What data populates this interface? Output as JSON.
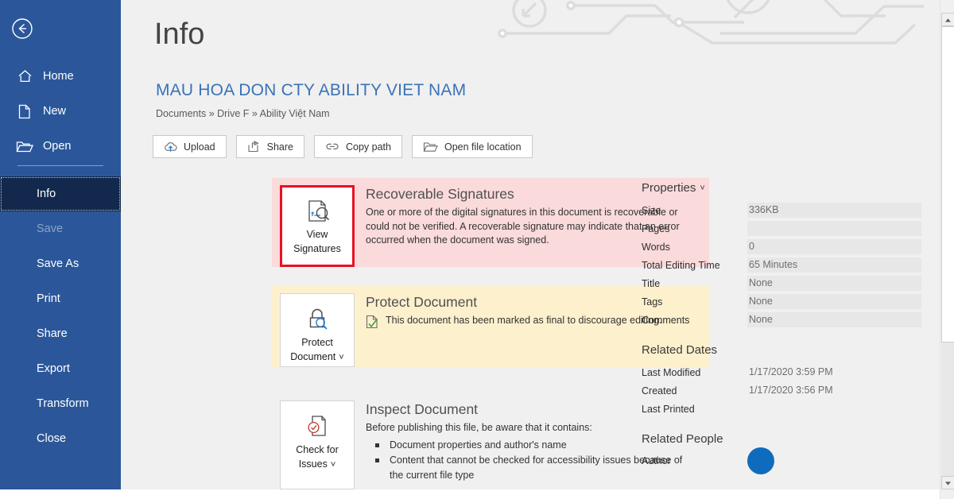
{
  "app": {
    "page_title": "Info"
  },
  "sidebar": {
    "back_icon": "back-arrow-icon",
    "top_items": [
      {
        "label": "Home",
        "icon": "home-icon"
      },
      {
        "label": "New",
        "icon": "new-document-icon"
      },
      {
        "label": "Open",
        "icon": "open-folder-icon"
      }
    ],
    "items": [
      {
        "label": "Info",
        "state": "selected"
      },
      {
        "label": "Save",
        "state": "disabled"
      },
      {
        "label": "Save As",
        "state": "normal"
      },
      {
        "label": "Print",
        "state": "normal"
      },
      {
        "label": "Share",
        "state": "normal"
      },
      {
        "label": "Export",
        "state": "normal"
      },
      {
        "label": "Transform",
        "state": "normal"
      },
      {
        "label": "Close",
        "state": "normal"
      }
    ]
  },
  "document": {
    "title": "MAU HOA DON CTY ABILITY VIET NAM",
    "breadcrumb": "Documents » Drive F » Ability Việt Nam"
  },
  "toolbar": {
    "upload_label": "Upload",
    "share_label": "Share",
    "copy_path_label": "Copy path",
    "open_file_location_label": "Open file location"
  },
  "panels": {
    "signatures": {
      "button_line1": "View",
      "button_line2": "Signatures",
      "heading": "Recoverable Signatures",
      "body": "One or more of the digital signatures in this document is recoverable or could not be verified. A recoverable signature may indicate that an error occurred when the document was signed.",
      "bg_color": "#fadada",
      "focus_color": "#e81123"
    },
    "protect": {
      "button_line1": "Protect",
      "button_line2": "Document",
      "button_chevron": "˅",
      "heading": "Protect Document",
      "body": "This document has been marked as final to discourage editing.",
      "bg_color": "#fdf0cd"
    },
    "inspect": {
      "button_line1": "Check for",
      "button_line2": "Issues",
      "button_chevron": "˅",
      "heading": "Inspect Document",
      "body": "Before publishing this file, be aware that it contains:",
      "bullets": [
        "Document properties and author's name",
        "Content that cannot be checked for accessibility issues because of the current file type"
      ]
    }
  },
  "properties": {
    "heading": "Properties",
    "chevron": "˅",
    "rows": [
      {
        "key": "Size",
        "value": "336KB"
      },
      {
        "key": "Pages",
        "value": ""
      },
      {
        "key": "Words",
        "value": "0"
      },
      {
        "key": "Total Editing Time",
        "value": "65 Minutes"
      },
      {
        "key": "Title",
        "value": "None"
      },
      {
        "key": "Tags",
        "value": "None"
      },
      {
        "key": "Comments",
        "value": "None"
      }
    ]
  },
  "related_dates": {
    "heading": "Related Dates",
    "rows": [
      {
        "key": "Last Modified",
        "value": "1/17/2020 3:59 PM"
      },
      {
        "key": "Created",
        "value": "1/17/2020 3:56 PM"
      },
      {
        "key": "Last Printed",
        "value": ""
      }
    ]
  },
  "related_people": {
    "heading": "Related People",
    "author_label": "Author"
  },
  "theme": {
    "sidebar_blue": "#2b579a",
    "selected_blue": "#12294d",
    "title_blue": "#3b72b7",
    "avatar_blue": "#0f6cbd"
  }
}
